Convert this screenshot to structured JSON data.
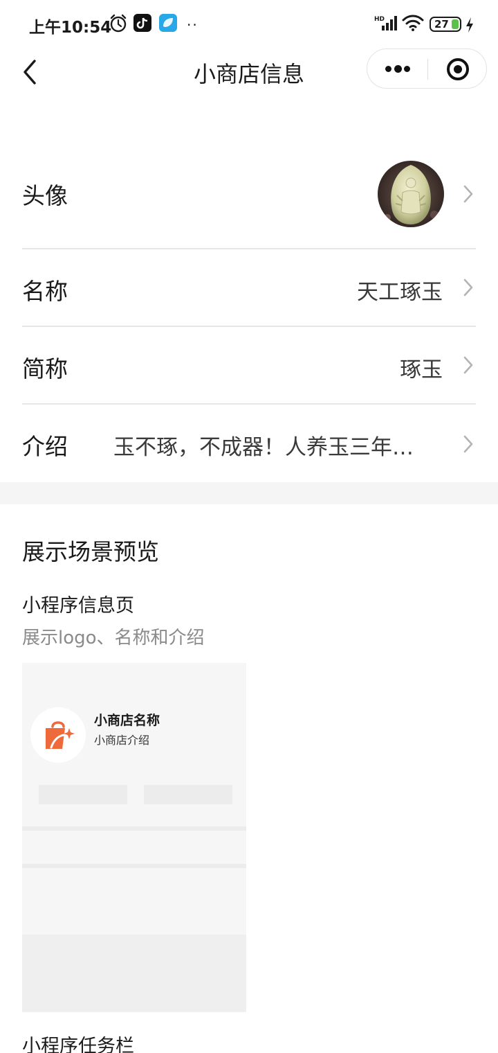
{
  "status_bar": {
    "time": "上午10:54",
    "battery": "27",
    "icons": [
      "alarm-icon",
      "tiktok-icon",
      "blue-app-icon",
      "more-dots-icon",
      "hd-signal-icon",
      "wifi-icon",
      "battery-icon",
      "charge-icon"
    ]
  },
  "nav": {
    "title": "小商店信息",
    "back_icon": "chevron-left-icon",
    "menu_icon": "more-dots-icon",
    "close_icon": "target-circle-icon"
  },
  "info_rows": [
    {
      "label": "头像",
      "value": ""
    },
    {
      "label": "名称",
      "value": "天工琢玉"
    },
    {
      "label": "简称",
      "value": "琢玉"
    },
    {
      "label": "介绍",
      "value": "玉不琢，不成器！人养玉三年…"
    }
  ],
  "preview": {
    "section_title": "展示场景预览",
    "info_page_title": "小程序信息页",
    "info_page_desc": "展示logo、名称和介绍",
    "card": {
      "shop_name": "小商店名称",
      "shop_intro": "小商店介绍",
      "logo_icon": "shopping-bag-icon",
      "logo_color": "#ee6a3a"
    },
    "taskbar_title": "小程序任务栏"
  },
  "colors": {
    "accent_orange": "#ee6a3a",
    "battery_green": "#5cc14a",
    "divider": "#e6e6e6"
  }
}
